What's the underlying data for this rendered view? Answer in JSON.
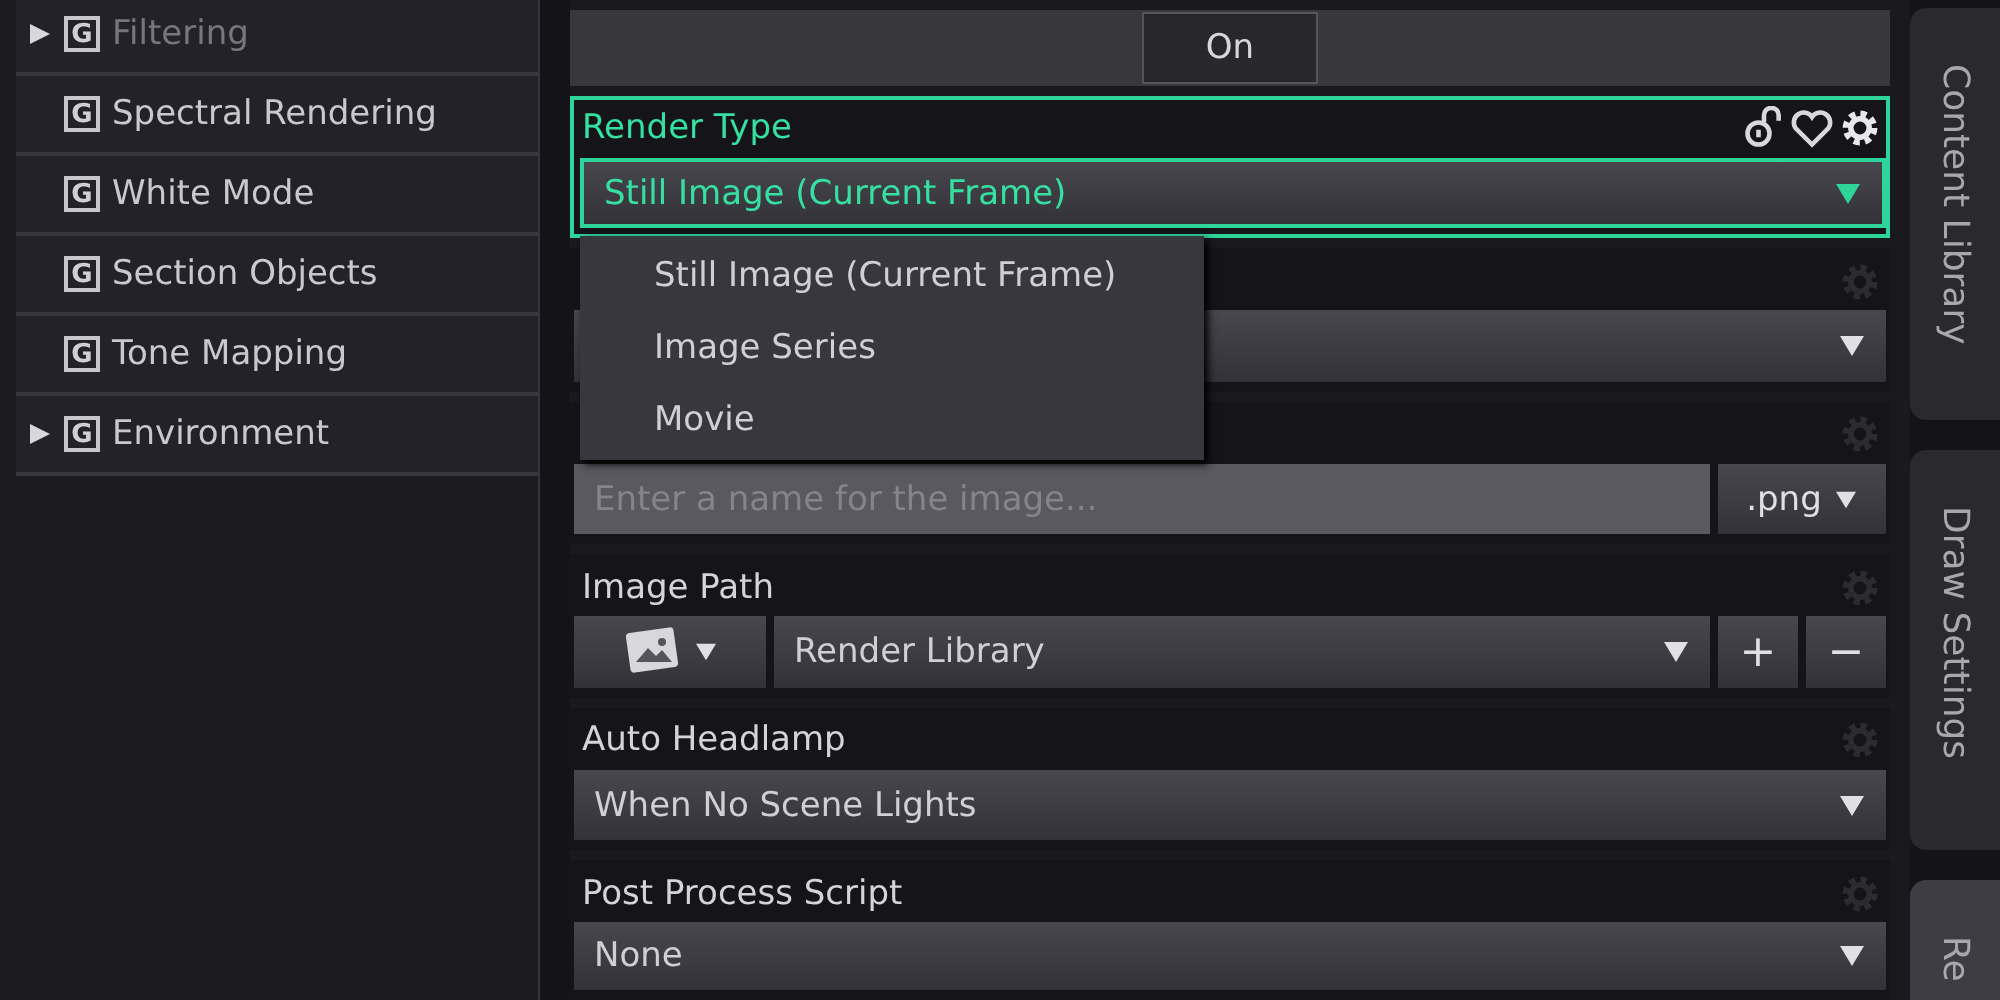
{
  "sidebar": {
    "items": [
      {
        "label": "Filtering",
        "badge": "G",
        "expandable": true,
        "disabled": true
      },
      {
        "label": "Spectral Rendering",
        "badge": "G",
        "expandable": false,
        "disabled": false
      },
      {
        "label": "White Mode",
        "badge": "G",
        "expandable": false,
        "disabled": false
      },
      {
        "label": "Section Objects",
        "badge": "G",
        "expandable": false,
        "disabled": false
      },
      {
        "label": "Tone Mapping",
        "badge": "G",
        "expandable": false,
        "disabled": false
      },
      {
        "label": "Environment",
        "badge": "G",
        "expandable": true,
        "disabled": false
      }
    ]
  },
  "toggle": {
    "value": "On"
  },
  "properties": [
    {
      "kind": "dropdown",
      "label": "Render Type",
      "value": "Still Image (Current Frame)",
      "highlighted": true,
      "menu": [
        "Still Image (Current Frame)",
        "Image Series",
        "Movie"
      ]
    },
    {
      "kind": "dropdown",
      "highlighted": false
    },
    {
      "kind": "filename",
      "placeholder": "Enter a name for the image...",
      "format": ".png",
      "highlighted": false
    },
    {
      "kind": "path",
      "label": "Image Path",
      "value": "Render Library",
      "add": "+",
      "remove": "−",
      "highlighted": false
    },
    {
      "kind": "dropdown",
      "label": "Auto Headlamp",
      "value": "When No Scene Lights",
      "highlighted": false
    },
    {
      "kind": "dropdown",
      "label": "Post Process Script",
      "value": "None",
      "highlighted": false
    }
  ],
  "side_tabs": [
    {
      "label": "Content Library",
      "selected": false
    },
    {
      "label": "Draw Settings",
      "selected": false
    },
    {
      "label": "Re",
      "selected": true
    }
  ]
}
